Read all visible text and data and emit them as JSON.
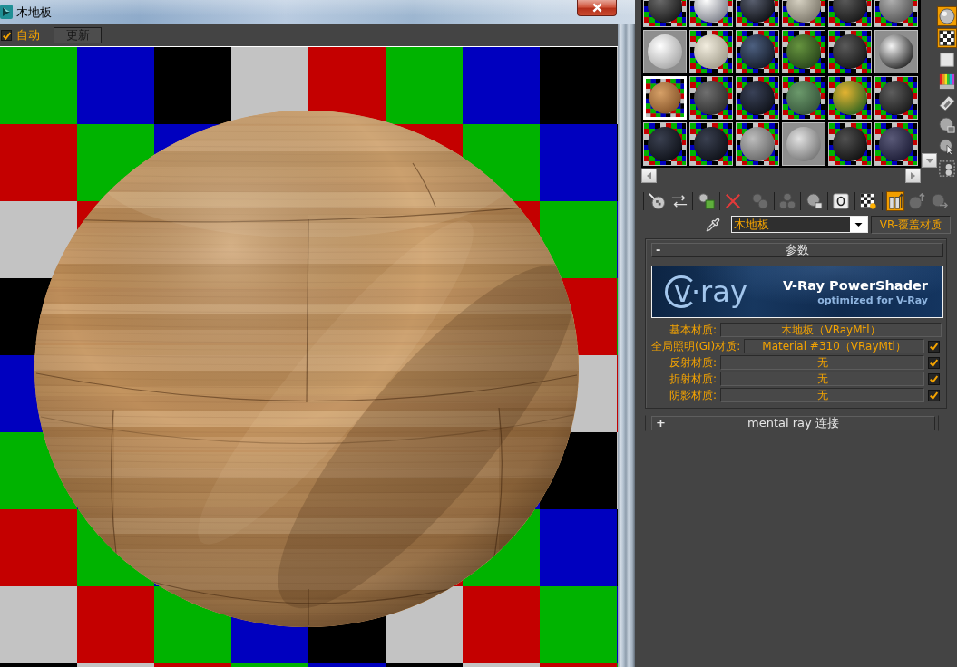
{
  "window": {
    "title": "木地板"
  },
  "toolbar": {
    "auto": {
      "label": "自动",
      "checked": true
    },
    "update_button": "更新"
  },
  "material_slots": [
    {
      "kind": "checker",
      "selected": false
    },
    {
      "kind": "checker",
      "selected": false
    },
    {
      "kind": "checker",
      "selected": false
    },
    {
      "kind": "checker",
      "selected": false
    },
    {
      "kind": "checker",
      "selected": false
    },
    {
      "kind": "checker",
      "selected": false
    },
    {
      "kind": "plain",
      "selected": false
    },
    {
      "kind": "checker",
      "selected": false
    },
    {
      "kind": "checker",
      "selected": false
    },
    {
      "kind": "checker",
      "selected": false
    },
    {
      "kind": "checker",
      "selected": false
    },
    {
      "kind": "plain",
      "selected": false
    },
    {
      "kind": "checker",
      "selected": true
    },
    {
      "kind": "checker",
      "selected": false
    },
    {
      "kind": "checker",
      "selected": false
    },
    {
      "kind": "checker",
      "selected": false
    },
    {
      "kind": "checker",
      "selected": false
    },
    {
      "kind": "checker",
      "selected": false
    },
    {
      "kind": "checker",
      "selected": false
    },
    {
      "kind": "checker",
      "selected": false
    },
    {
      "kind": "checker",
      "selected": false
    },
    {
      "kind": "plain",
      "selected": false
    },
    {
      "kind": "checker",
      "selected": false
    },
    {
      "kind": "checker",
      "selected": false
    }
  ],
  "slot_tools": [
    {
      "kind": "sphere",
      "on": true
    },
    {
      "kind": "checker",
      "on": true
    },
    {
      "kind": "square",
      "on": false
    },
    {
      "kind": "spectrum",
      "on": false
    },
    {
      "kind": "film",
      "on": false
    },
    {
      "kind": "spheres",
      "on": false
    },
    {
      "kind": "cursor",
      "on": false
    },
    {
      "kind": "select",
      "on": false
    }
  ],
  "editor_tools": [
    {
      "kind": "pick",
      "on": false,
      "disabled": false
    },
    {
      "kind": "swap",
      "on": false,
      "disabled": false
    },
    {
      "kind": "cube",
      "on": false,
      "disabled": false
    },
    {
      "kind": "cross",
      "on": false,
      "disabled": false
    },
    {
      "kind": "pair",
      "on": false,
      "disabled": true
    },
    {
      "kind": "trio",
      "on": false,
      "disabled": true
    },
    {
      "kind": "stack",
      "on": false,
      "disabled": false
    },
    {
      "kind": "ring",
      "on": false,
      "disabled": false
    },
    {
      "kind": "bulb",
      "on": false,
      "disabled": false
    },
    {
      "kind": "bars",
      "on": true,
      "disabled": false
    },
    {
      "kind": "up",
      "on": false,
      "disabled": true
    },
    {
      "kind": "next",
      "on": false,
      "disabled": true
    }
  ],
  "material": {
    "name": "木地板",
    "type_button": "VR-覆盖材质"
  },
  "rollouts": [
    {
      "toggle": "-",
      "title": "参数",
      "expanded": true,
      "banner": {
        "logo": "v·ray",
        "title": "V-Ray PowerShader",
        "subtitle": "optimized for V-Ray"
      },
      "rows": [
        {
          "kind": "plain",
          "label": "基本材质:",
          "value": "木地板（VRayMtl）"
        },
        {
          "kind": "toggle",
          "label": "全局照明(GI)材质:",
          "value": "Material #310（VRayMtl）",
          "checked": true
        },
        {
          "kind": "toggle",
          "label": "反射材质:",
          "value": "无",
          "checked": true
        },
        {
          "kind": "toggle",
          "label": "折射材质:",
          "value": "无",
          "checked": true
        },
        {
          "kind": "toggle",
          "label": "阴影材质:",
          "value": "无",
          "checked": true
        }
      ]
    },
    {
      "toggle": "+",
      "title": "mental ray 连接",
      "expanded": false
    }
  ]
}
